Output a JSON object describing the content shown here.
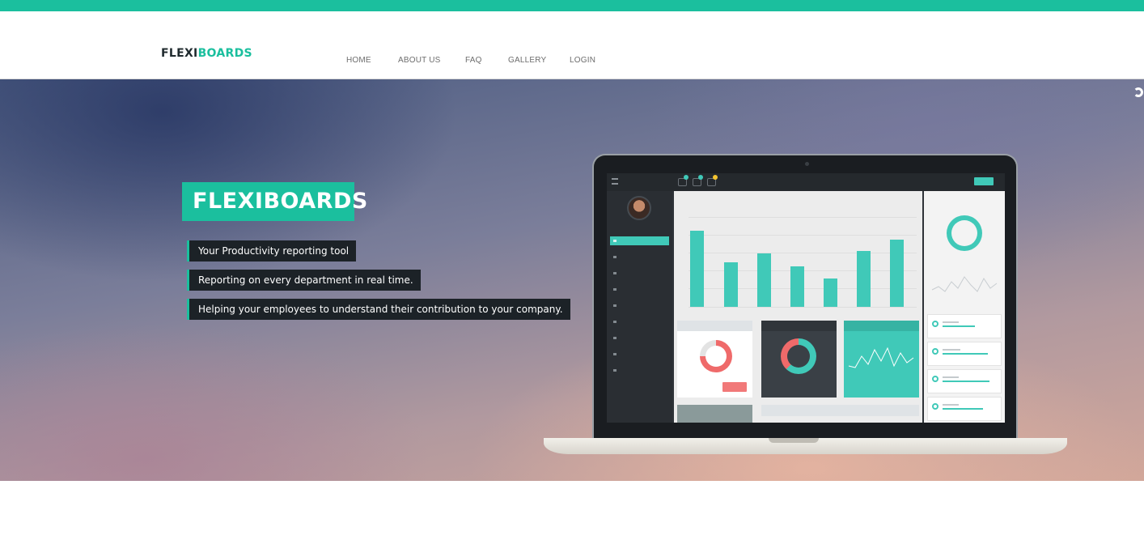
{
  "brand": {
    "part1": "FLEXI",
    "part2": "BOARDS"
  },
  "nav": [
    "HOME",
    "ABOUT US",
    "FAQ",
    "GALLERY",
    "LOGIN"
  ],
  "hero": {
    "title": "FLEXIBOARDS",
    "taglines": [
      "Your Productivity reporting tool",
      "Reporting on every department in real time.",
      "Helping your employees to understand their contribution to your company."
    ]
  },
  "colors": {
    "accent": "#1bbf9e",
    "dark": "#1c2227"
  }
}
